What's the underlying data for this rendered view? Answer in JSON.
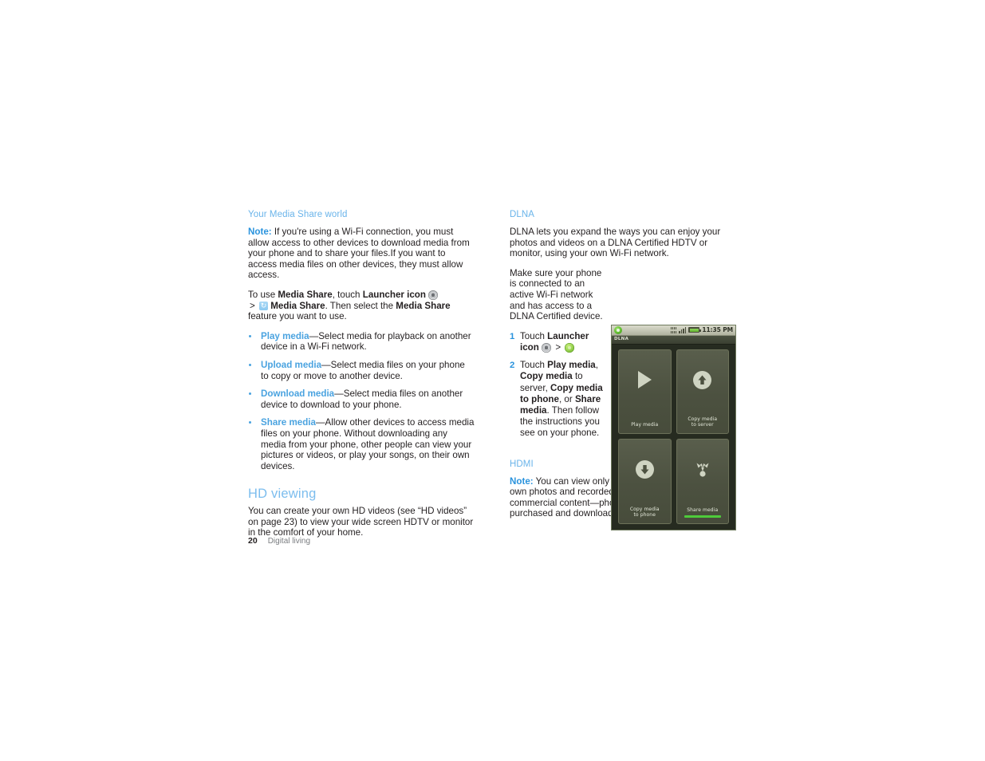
{
  "left_column": {
    "heading": "Your Media Share world",
    "note": {
      "label": "Note:",
      "text": " If you're using a Wi-Fi connection, you must allow access to other devices to download media from your phone and to share your files.If you want to access media files on other devices, they must allow access."
    },
    "instruction": {
      "part1": "To use ",
      "bold1": "Media Share",
      "part2": ", touch ",
      "bold2": "Launcher icon",
      "icon1": "launcher-icon",
      "separator": ">",
      "icon2": "media-share-icon",
      "bold3": "Media Share",
      "part3": ". Then select the ",
      "bold4": "Media Share",
      "part4": " feature you want to use."
    },
    "bullets": [
      {
        "term": "Play media",
        "text": "—Select media for playback on another device in a Wi-Fi network."
      },
      {
        "term": "Upload media",
        "text": "—Select media files on your phone to copy or move to another device."
      },
      {
        "term": "Download media",
        "text": "—Select media files on another device to download to your phone."
      },
      {
        "term": "Share media",
        "text": "—Allow other devices to access media files on your phone. Without downloading any media from your phone, other people can view your pictures or videos, or play your songs, on their own devices."
      }
    ],
    "hd_viewing": {
      "heading": "HD viewing",
      "body": "You can create your own HD videos (see “HD videos” on page 23) to view your wide screen HDTV or monitor in the comfort of your home."
    }
  },
  "right_column": {
    "dlna": {
      "heading": "DLNA",
      "intro": "DLNA lets you expand the ways you can enjoy your photos and videos on a DLNA Certified HDTV or monitor, using your own Wi-Fi network.",
      "setup": "Make sure your phone is connected to an active Wi-Fi network and has access to a DLNA Certified device."
    },
    "steps": [
      {
        "num": "1",
        "p1": "Touch ",
        "b1": "Launcher icon",
        "icon1": "launcher-icon",
        "sep": ">",
        "icon2": "dlna-green-icon"
      },
      {
        "num": "2",
        "p1": "Touch ",
        "b1": "Play media",
        "p2": ", ",
        "b2": "Copy media",
        "p3": " to server, ",
        "b3": "Copy media to phone",
        "p4": ", or ",
        "b4": "Share media",
        "p5": ". Then follow the instructions you see on your phone."
      }
    ],
    "hdmi": {
      "heading": "HDMI",
      "note_label": "Note:",
      "note_text": " You can view only user-generated content—your own photos and recorded videos . You cannot view commercial content—photos or videos that you purchased and downloaded"
    }
  },
  "phone_screenshot": {
    "status_bar": {
      "sync_icon": "sync-icon",
      "data_icon": "data-transfer-icon",
      "signal_icon": "signal-bars-icon",
      "battery_icon": "battery-icon",
      "time": "11:35 PM"
    },
    "app_title": "DLNA",
    "tiles": [
      {
        "label": "Play media",
        "icon": "play-icon",
        "selected": false
      },
      {
        "label": "Copy media\nto server",
        "icon": "upload-circle-icon",
        "selected": false
      },
      {
        "label": "Copy media\nto phone",
        "icon": "download-circle-icon",
        "selected": false
      },
      {
        "label": "Share media",
        "icon": "share-nodes-icon",
        "selected": true
      }
    ]
  },
  "footer": {
    "page_number": "20",
    "section": "Digital living"
  },
  "colors": {
    "heading_blue": "#6ab4ea",
    "large_heading_blue": "#7cbdee",
    "note_blue": "#2a93dd",
    "term_blue": "#4aa3e0",
    "body_text": "#231f20",
    "footer_gray": "#7a7d80",
    "phone_bg": "#262b20",
    "tile_bg": "#4c5140",
    "selected_green": "#4ecb3a"
  }
}
